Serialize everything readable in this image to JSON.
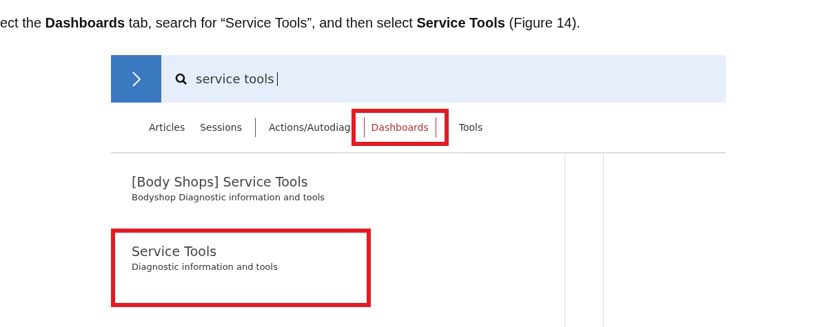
{
  "instruction": "ect the **Dashboards** tab, search for “Service Tools”, and then select **Service Tools** (Figure 14).",
  "screenshot": {
    "search": {
      "value": "service tools"
    },
    "tabs": [
      {
        "label": "Articles",
        "selected": false,
        "highlighted": false,
        "separator_after": false
      },
      {
        "label": "Sessions",
        "selected": false,
        "highlighted": false,
        "separator_after": true
      },
      {
        "label": "Actions/Autodiag",
        "selected": false,
        "highlighted": false,
        "separator_after": false
      },
      {
        "label": "Dashboards",
        "selected": true,
        "highlighted": true,
        "separator_after": false
      },
      {
        "label": "Tools",
        "selected": false,
        "highlighted": false,
        "separator_after": false
      }
    ],
    "results": [
      {
        "title": "[Body Shops] Service Tools",
        "description": "Bodyshop Diagnostic information and tools",
        "highlighted": false
      },
      {
        "title": "Service Tools",
        "description": "Diagnostic information and tools",
        "highlighted": true
      }
    ]
  }
}
